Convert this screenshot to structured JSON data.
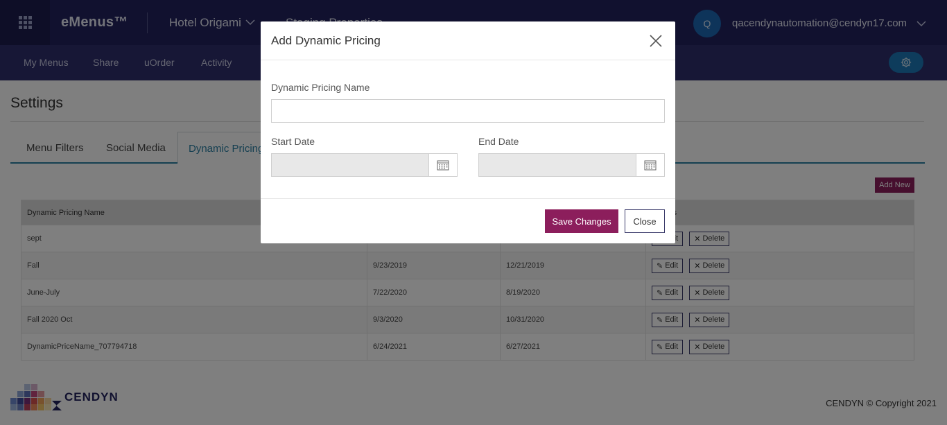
{
  "topbar": {
    "apps_icon": "apps-grid-icon",
    "brand": "eMenus™",
    "hotel": "Hotel Origami",
    "property": "Staging Properties",
    "avatar_initial": "Q",
    "user_email": "qacendynautomation@cendyn17.com"
  },
  "subnav": {
    "items": [
      "My Menus",
      "Share",
      "uOrder",
      "Activity"
    ],
    "settings_icon": "gear-icon"
  },
  "page": {
    "title": "Settings",
    "tabs": [
      "Menu Filters",
      "Social Media",
      "Dynamic Pricing"
    ],
    "active_tab": "Dynamic Pricing",
    "add_new_label": "Add New"
  },
  "table": {
    "headers": [
      "Dynamic Pricing Name",
      "",
      "",
      "Actions"
    ],
    "rows": [
      {
        "name": "sept",
        "start": "",
        "end": ""
      },
      {
        "name": "Fall",
        "start": "9/23/2019",
        "end": "12/21/2019"
      },
      {
        "name": "June-July",
        "start": "7/22/2020",
        "end": "8/19/2020"
      },
      {
        "name": "Fall 2020 Oct",
        "start": "9/3/2020",
        "end": "10/31/2020"
      },
      {
        "name": "DynamicPriceName_707794718",
        "start": "6/24/2021",
        "end": "6/27/2021"
      }
    ],
    "edit_label": "Edit",
    "delete_label": "Delete"
  },
  "footer": {
    "logo_text": "CENDYN",
    "copyright": "CENDYN © Copyright 2021"
  },
  "modal": {
    "title": "Add Dynamic Pricing",
    "name_label": "Dynamic Pricing Name",
    "name_value": "",
    "start_label": "Start Date",
    "start_value": "",
    "end_label": "End Date",
    "end_value": "",
    "save_label": "Save Changes",
    "close_label": "Close"
  },
  "colors": {
    "topbar": "#23235f",
    "subnav": "#2e2e6c",
    "accent": "#8c1e5c",
    "tab_active": "#2a7fa3",
    "avatar": "#1d68b5"
  }
}
